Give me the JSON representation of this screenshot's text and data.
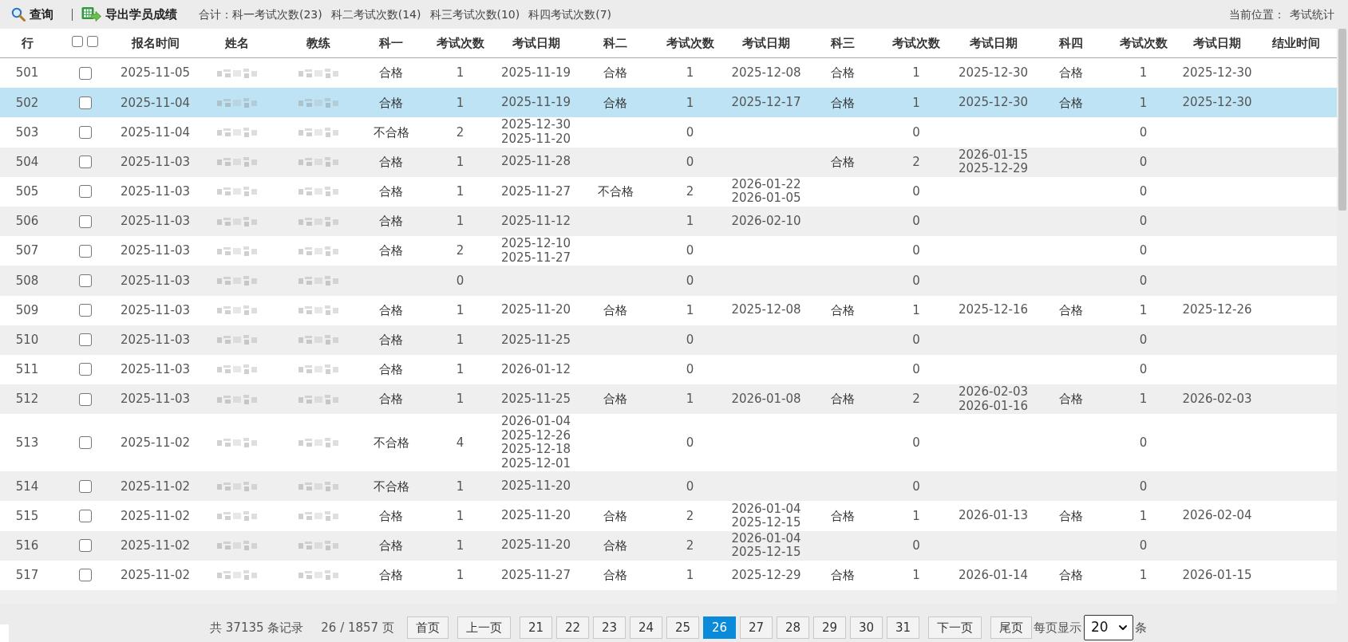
{
  "toolbar": {
    "actions": [
      {
        "kind": "search",
        "label": "查询"
      },
      {
        "kind": "export",
        "label": "导出学员成绩"
      }
    ],
    "totals": [
      "合计：科一考试次数(23)",
      "科二考试次数(14)",
      "科三考试次数(10)",
      "科四考试次数(7)"
    ],
    "breadcrumb": {
      "label": "当前位置：",
      "current": "考试统计"
    }
  },
  "table": {
    "columns": [
      {
        "kind": "label",
        "label": "行"
      },
      {
        "kind": "checkboxes",
        "checkboxes": [
          {
            "checked": false
          },
          {
            "checked": false
          }
        ]
      },
      {
        "kind": "label",
        "label": "报名时间"
      },
      {
        "kind": "label",
        "label": "姓名"
      },
      {
        "kind": "label",
        "label": "教练"
      },
      {
        "kind": "label",
        "label": "科一"
      },
      {
        "kind": "label",
        "label": "考试次数"
      },
      {
        "kind": "label",
        "label": "考试日期"
      },
      {
        "kind": "label",
        "label": "科二"
      },
      {
        "kind": "label",
        "label": "考试次数"
      },
      {
        "kind": "label",
        "label": "考试日期"
      },
      {
        "kind": "label",
        "label": "科三"
      },
      {
        "kind": "label",
        "label": "考试次数"
      },
      {
        "kind": "label",
        "label": "考试日期"
      },
      {
        "kind": "label",
        "label": "科四"
      },
      {
        "kind": "label",
        "label": "考试次数"
      },
      {
        "kind": "label",
        "label": "考试日期"
      },
      {
        "kind": "label",
        "label": "结业时间"
      }
    ],
    "rows": [
      {
        "row": "501",
        "checked": false,
        "selected": false,
        "registered": "2025-11-05",
        "subjects": [
          {
            "result": "合格",
            "attempts": "1",
            "dates": [
              "2025-11-19"
            ]
          },
          {
            "result": "合格",
            "attempts": "1",
            "dates": [
              "2025-12-08"
            ]
          },
          {
            "result": "合格",
            "attempts": "1",
            "dates": [
              "2025-12-30"
            ]
          },
          {
            "result": "合格",
            "attempts": "1",
            "dates": [
              "2025-12-30"
            ]
          }
        ]
      },
      {
        "row": "502",
        "checked": false,
        "selected": true,
        "registered": "2025-11-04",
        "subjects": [
          {
            "result": "合格",
            "attempts": "1",
            "dates": [
              "2025-11-19"
            ]
          },
          {
            "result": "合格",
            "attempts": "1",
            "dates": [
              "2025-12-17"
            ]
          },
          {
            "result": "合格",
            "attempts": "1",
            "dates": [
              "2025-12-30"
            ]
          },
          {
            "result": "合格",
            "attempts": "1",
            "dates": [
              "2025-12-30"
            ]
          }
        ]
      },
      {
        "row": "503",
        "checked": false,
        "selected": false,
        "registered": "2025-11-04",
        "subjects": [
          {
            "result": "不合格",
            "attempts": "2",
            "dates": [
              "2025-12-30",
              "2025-11-20"
            ]
          },
          {
            "attempts": "0"
          },
          {
            "attempts": "0"
          },
          {
            "attempts": "0"
          }
        ]
      },
      {
        "row": "504",
        "checked": false,
        "selected": false,
        "registered": "2025-11-03",
        "subjects": [
          {
            "result": "合格",
            "attempts": "1",
            "dates": [
              "2025-11-28"
            ]
          },
          {
            "attempts": "0"
          },
          {
            "result": "合格",
            "attempts": "2",
            "dates": [
              "2026-01-15",
              "2025-12-29"
            ]
          },
          {
            "attempts": "0"
          }
        ]
      },
      {
        "row": "505",
        "checked": false,
        "selected": false,
        "registered": "2025-11-03",
        "subjects": [
          {
            "result": "合格",
            "attempts": "1",
            "dates": [
              "2025-11-27"
            ]
          },
          {
            "result": "不合格",
            "attempts": "2",
            "dates": [
              "2026-01-22",
              "2026-01-05"
            ]
          },
          {
            "attempts": "0"
          },
          {
            "attempts": "0"
          }
        ]
      },
      {
        "row": "506",
        "checked": false,
        "selected": false,
        "registered": "2025-11-03",
        "subjects": [
          {
            "result": "合格",
            "attempts": "1",
            "dates": [
              "2025-11-12"
            ]
          },
          {
            "attempts": "1",
            "dates": [
              "2026-02-10"
            ]
          },
          {
            "attempts": "0"
          },
          {
            "attempts": "0"
          }
        ]
      },
      {
        "row": "507",
        "checked": false,
        "selected": false,
        "registered": "2025-11-03",
        "subjects": [
          {
            "result": "合格",
            "attempts": "2",
            "dates": [
              "2025-12-10",
              "2025-11-27"
            ]
          },
          {
            "attempts": "0"
          },
          {
            "attempts": "0"
          },
          {
            "attempts": "0"
          }
        ]
      },
      {
        "row": "508",
        "checked": false,
        "selected": false,
        "registered": "2025-11-03",
        "subjects": [
          {
            "attempts": "0"
          },
          {
            "attempts": "0"
          },
          {
            "attempts": "0"
          },
          {
            "attempts": "0"
          }
        ]
      },
      {
        "row": "509",
        "checked": false,
        "selected": false,
        "registered": "2025-11-03",
        "subjects": [
          {
            "result": "合格",
            "attempts": "1",
            "dates": [
              "2025-11-20"
            ]
          },
          {
            "result": "合格",
            "attempts": "1",
            "dates": [
              "2025-12-08"
            ]
          },
          {
            "result": "合格",
            "attempts": "1",
            "dates": [
              "2025-12-16"
            ]
          },
          {
            "result": "合格",
            "attempts": "1",
            "dates": [
              "2025-12-26"
            ]
          }
        ]
      },
      {
        "row": "510",
        "checked": false,
        "selected": false,
        "registered": "2025-11-03",
        "subjects": [
          {
            "result": "合格",
            "attempts": "1",
            "dates": [
              "2025-11-25"
            ]
          },
          {
            "attempts": "0"
          },
          {
            "attempts": "0"
          },
          {
            "attempts": "0"
          }
        ]
      },
      {
        "row": "511",
        "checked": false,
        "selected": false,
        "registered": "2025-11-03",
        "subjects": [
          {
            "result": "合格",
            "attempts": "1",
            "dates": [
              "2026-01-12"
            ]
          },
          {
            "attempts": "0"
          },
          {
            "attempts": "0"
          },
          {
            "attempts": "0"
          }
        ]
      },
      {
        "row": "512",
        "checked": false,
        "selected": false,
        "registered": "2025-11-03",
        "subjects": [
          {
            "result": "合格",
            "attempts": "1",
            "dates": [
              "2025-11-25"
            ]
          },
          {
            "result": "合格",
            "attempts": "1",
            "dates": [
              "2026-01-08"
            ]
          },
          {
            "result": "合格",
            "attempts": "2",
            "dates": [
              "2026-02-03",
              "2026-01-16"
            ]
          },
          {
            "result": "合格",
            "attempts": "1",
            "dates": [
              "2026-02-03"
            ]
          }
        ]
      },
      {
        "row": "513",
        "checked": false,
        "selected": false,
        "registered": "2025-11-02",
        "subjects": [
          {
            "result": "不合格",
            "attempts": "4",
            "dates": [
              "2026-01-04",
              "2025-12-26",
              "2025-12-18",
              "2025-12-01"
            ]
          },
          {
            "attempts": "0"
          },
          {
            "attempts": "0"
          },
          {
            "attempts": "0"
          }
        ]
      },
      {
        "row": "514",
        "checked": false,
        "selected": false,
        "registered": "2025-11-02",
        "subjects": [
          {
            "result": "不合格",
            "attempts": "1",
            "dates": [
              "2025-11-20"
            ]
          },
          {
            "attempts": "0"
          },
          {
            "attempts": "0"
          },
          {
            "attempts": "0"
          }
        ]
      },
      {
        "row": "515",
        "checked": false,
        "selected": false,
        "registered": "2025-11-02",
        "subjects": [
          {
            "result": "合格",
            "attempts": "1",
            "dates": [
              "2025-11-20"
            ]
          },
          {
            "result": "合格",
            "attempts": "2",
            "dates": [
              "2026-01-04",
              "2025-12-15"
            ]
          },
          {
            "result": "合格",
            "attempts": "1",
            "dates": [
              "2026-01-13"
            ]
          },
          {
            "result": "合格",
            "attempts": "1",
            "dates": [
              "2026-02-04"
            ]
          }
        ]
      },
      {
        "row": "516",
        "checked": false,
        "selected": false,
        "registered": "2025-11-02",
        "subjects": [
          {
            "result": "合格",
            "attempts": "1",
            "dates": [
              "2025-11-20"
            ]
          },
          {
            "result": "合格",
            "attempts": "2",
            "dates": [
              "2026-01-04",
              "2025-12-15"
            ]
          },
          {
            "attempts": "0"
          },
          {
            "attempts": "0"
          }
        ]
      },
      {
        "row": "517",
        "checked": false,
        "selected": false,
        "registered": "2025-11-02",
        "subjects": [
          {
            "result": "合格",
            "attempts": "1",
            "dates": [
              "2025-11-27"
            ]
          },
          {
            "result": "合格",
            "attempts": "1",
            "dates": [
              "2025-12-29"
            ]
          },
          {
            "result": "合格",
            "attempts": "1",
            "dates": [
              "2026-01-14"
            ]
          },
          {
            "result": "合格",
            "attempts": "1",
            "dates": [
              "2026-01-15"
            ]
          }
        ]
      }
    ]
  },
  "pagination": {
    "records": "共 37135 条记录",
    "page_info": "26 / 1857 页",
    "first": "首页",
    "prev": "上一页",
    "pages": [
      {
        "label": "21",
        "selected": false
      },
      {
        "label": "22",
        "selected": false
      },
      {
        "label": "23",
        "selected": false
      },
      {
        "label": "24",
        "selected": false
      },
      {
        "label": "25",
        "selected": false
      },
      {
        "label": "26",
        "selected": true
      },
      {
        "label": "27",
        "selected": false
      },
      {
        "label": "28",
        "selected": false
      },
      {
        "label": "29",
        "selected": false
      },
      {
        "label": "30",
        "selected": false
      },
      {
        "label": "31",
        "selected": false
      }
    ],
    "next": "下一页",
    "last": "尾页",
    "per_page_label": "每页显示",
    "per_page": "20",
    "per_page_suffix": "条"
  }
}
